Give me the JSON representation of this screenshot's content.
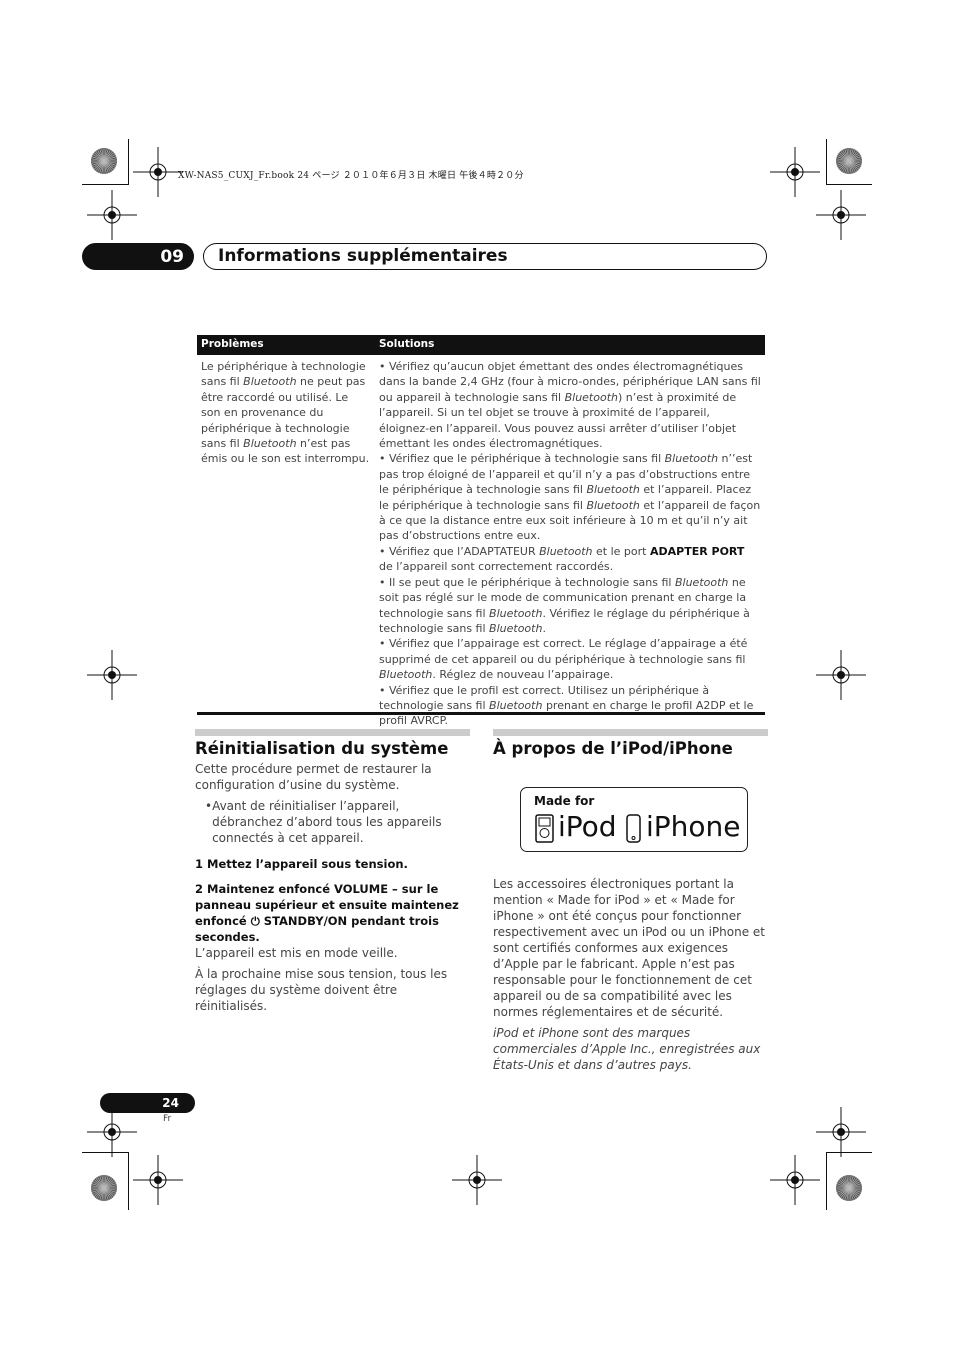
{
  "print_header": "XW-NAS5_CUXJ_Fr.book  24 ページ  ２０１０年６月３日  木曜日  午後４時２０分",
  "chapter": {
    "number": "09",
    "title": "Informations supplémentaires"
  },
  "table": {
    "headers": [
      "Problèmes",
      "Solutions"
    ],
    "problem": [
      [
        "n",
        "Le périphérique à technologie sans fil "
      ],
      [
        "i",
        "Bluetooth"
      ],
      [
        "n",
        " ne peut pas être raccordé ou utilisé. Le son en provenance du périphérique à technologie sans fil "
      ],
      [
        "i",
        "Bluetooth"
      ],
      [
        "n",
        " n’est pas émis ou le son est interrompu."
      ]
    ],
    "solutions": [
      [
        [
          "n",
          "• Vérifiez qu’aucun objet émettant des ondes électromagnétiques dans la bande 2,4 GHz (four à micro-ondes, périphérique LAN sans fil ou appareil à technologie sans fil "
        ],
        [
          "i",
          "Bluetooth"
        ],
        [
          "n",
          ") n’est à proximité de l’appareil. Si un tel objet se trouve à proximité de l’appareil, éloignez-en l’appareil. Vous pouvez aussi arrêter d’utiliser l’objet émettant les ondes électromagnétiques."
        ]
      ],
      [
        [
          "n",
          "• Vérifiez que le périphérique à technologie sans fil "
        ],
        [
          "i",
          "Bluetooth"
        ],
        [
          "n",
          " n’’est pas trop éloigné de l’appareil et qu’il n’y a pas d’obstructions entre le périphérique à technologie sans fil "
        ],
        [
          "i",
          "Bluetooth"
        ],
        [
          "n",
          " et l’appareil. Placez le périphérique à technologie sans fil "
        ],
        [
          "i",
          "Bluetooth"
        ],
        [
          "n",
          " et l’appareil de façon à ce que la distance entre eux soit inférieure à 10 m et qu’il n’y ait pas d’obstructions entre eux."
        ]
      ],
      [
        [
          "n",
          "• Vérifiez que l’ADAPTATEUR "
        ],
        [
          "i",
          "Bluetooth"
        ],
        [
          "n",
          " et le port "
        ],
        [
          "b",
          "ADAPTER PORT"
        ],
        [
          "n",
          " de l’appareil sont correctement raccordés."
        ]
      ],
      [
        [
          "n",
          "• Il se peut que le périphérique à technologie sans fil "
        ],
        [
          "i",
          "Bluetooth"
        ],
        [
          "n",
          " ne soit pas réglé sur le mode de communication prenant en charge la technologie sans fil "
        ],
        [
          "i",
          "Bluetooth"
        ],
        [
          "n",
          ". Vérifiez le réglage du périphérique à technologie sans fil "
        ],
        [
          "i",
          "Bluetooth"
        ],
        [
          "n",
          "."
        ]
      ],
      [
        [
          "n",
          "• Vérifiez que l’appairage est correct. Le réglage d’appairage a été supprimé de cet appareil ou du périphérique à technologie sans fil "
        ],
        [
          "i",
          "Bluetooth"
        ],
        [
          "n",
          ". Réglez de nouveau l’appairage."
        ]
      ],
      [
        [
          "n",
          "• Vérifiez que le profil est correct. Utilisez un périphérique à technologie sans fil "
        ],
        [
          "i",
          "Bluetooth"
        ],
        [
          "n",
          " prenant en charge le profil A2DP et le profil AVRCP."
        ]
      ]
    ]
  },
  "reset": {
    "title": "Réinitialisation du système",
    "intro": "Cette procédure permet de restaurer la configuration d’usine du système.",
    "bullet": "Avant de réinitialiser l’appareil, débranchez d’abord tous les appareils connectés à cet appareil.",
    "step1": "1    Mettez l’appareil sous tension.",
    "step2": "2    Maintenez enfoncé VOLUME – sur le panneau supérieur et ensuite maintenez enfoncé ⏻ STANDBY/ON pendant trois secondes.",
    "result": "L’appareil est mis en mode veille.",
    "note": "À la prochaine mise sous tension, tous les réglages du système doivent être réinitialisés."
  },
  "ipod": {
    "title": "À propos de l’iPod/iPhone",
    "logo": {
      "made_for": "Made for",
      "ipod": "iPod",
      "iphone": "iPhone"
    },
    "body": "Les accessoires électroniques portant la mention « Made for iPod » et « Made for iPhone » ont été conçus pour fonctionner respectivement avec un iPod ou un iPhone et sont certifiés conformes aux exigences d’Apple par le fabricant. Apple n’est pas responsable pour le fonctionnement de cet appareil ou de sa compatibilité avec les normes réglementaires et de sécurité.",
    "trademark": "iPod et iPhone sont des marques commerciales d’Apple Inc., enregistrées aux États-Unis et dans d’autres pays."
  },
  "footer": {
    "page": "24",
    "lang": "Fr"
  }
}
